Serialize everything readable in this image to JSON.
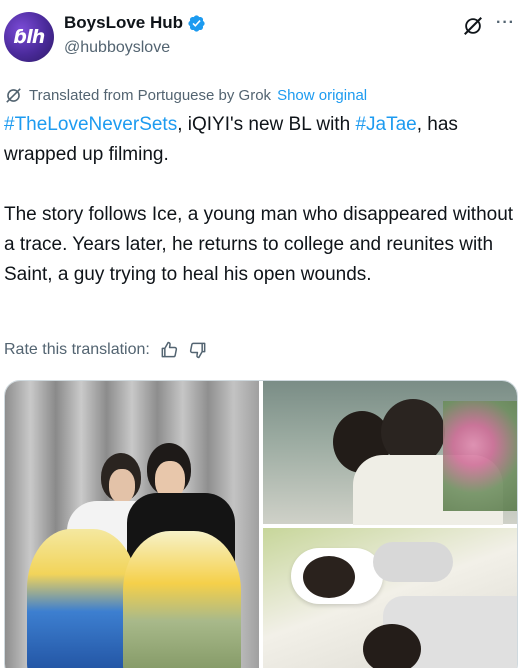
{
  "header": {
    "avatar_text": "ɓlh",
    "display_name": "BoysLove Hub",
    "handle": "@hubboyslove",
    "more": "···"
  },
  "translation": {
    "note": "Translated from Portuguese by Grok",
    "show_original": "Show original"
  },
  "tweet": {
    "hashtag1": "#TheLoveNeverSets",
    "text1": ", iQIYI's new BL with ",
    "hashtag2": "#JaTae",
    "text2": ", has wrapped up filming.",
    "paragraph2": "The story follows Ice, a young man who disappeared without a trace. Years later, he returns to college and reunites with Saint, a guy trying to heal his open wounds."
  },
  "rate": {
    "label": "Rate this translation:"
  },
  "colors": {
    "accent": "#1d9bf0",
    "secondary_text": "#536471",
    "verified": "#1d9bf0"
  },
  "icons": {
    "verified": "verified-badge-icon",
    "grok": "grok-icon",
    "thumbs_up": "thumbs-up-icon",
    "thumbs_down": "thumbs-down-icon"
  }
}
